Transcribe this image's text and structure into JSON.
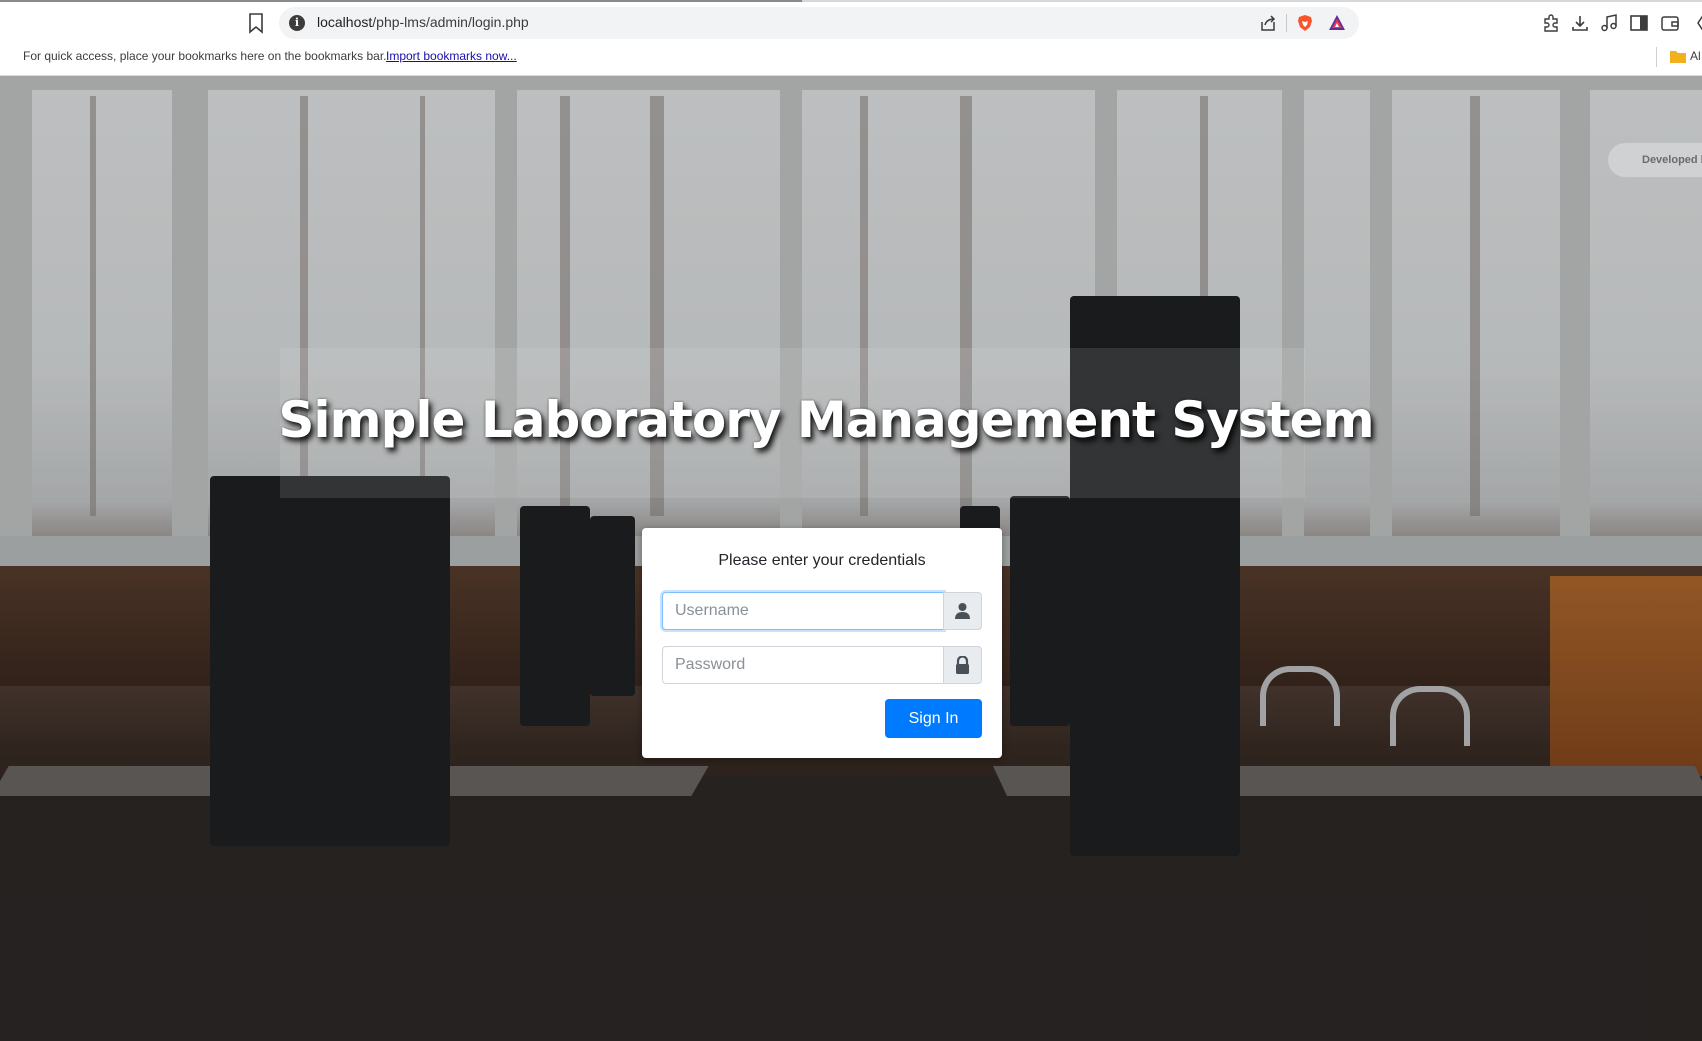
{
  "browser": {
    "url_host": "localhost",
    "url_path": "/php-lms/admin/login.php",
    "icons": [
      "bookmark-icon",
      "site-info-icon",
      "share-icon",
      "brave-shields-icon",
      "brave-rewards-icon",
      "extensions-icon",
      "downloads-icon",
      "media-icon",
      "sidebar-icon",
      "wallet-icon",
      "leo-icon"
    ],
    "site_info_glyph": "i"
  },
  "bookmarks_bar": {
    "message": "For quick access, place your bookmarks here on the bookmarks bar.",
    "import_link": "Import bookmarks now...",
    "all_bookmarks": "Al"
  },
  "page": {
    "title": "Simple Laboratory Management System",
    "developed_badge": "Developed b"
  },
  "login": {
    "message": "Please enter your credentials",
    "username_placeholder": "Username",
    "password_placeholder": "Password",
    "submit_label": "Sign In",
    "accent_color": "#007bff"
  }
}
